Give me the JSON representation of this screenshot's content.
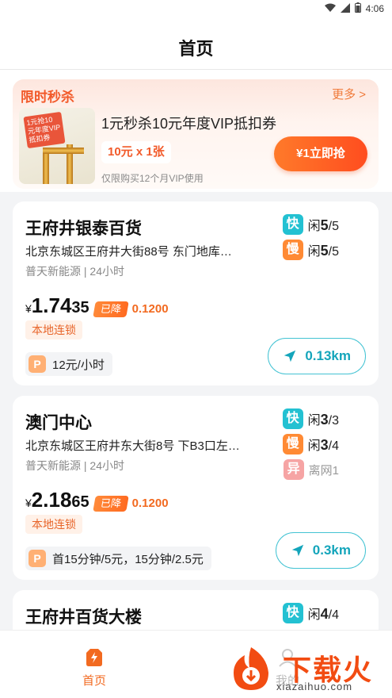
{
  "status": {
    "time": "4:06"
  },
  "header": {
    "title": "首页"
  },
  "promo": {
    "label": "限时秒杀",
    "more": "更多 >",
    "thumb_text": "1元抢10元年度VIP抵扣券",
    "title": "1元秒杀10元年度VIP抵扣券",
    "price_tag": "10元 x 1张",
    "note": "仅限购买12个月VIP使用",
    "buy_label": "¥1立即抢"
  },
  "stations": [
    {
      "name": "王府井银泰百货",
      "address": "北京东城区王府井大街88号 东门地库…",
      "operator": "普天新能源 | 24小时",
      "yen": "¥",
      "price_big": "1.74",
      "price_small": "35",
      "drop_label": "已降",
      "drop_value": "0.1200",
      "chain": "本地连锁",
      "fee_icon": "P",
      "fee": "12元/小时",
      "distance": "0.13km",
      "fast": {
        "badge": "快",
        "prefix": "闲",
        "free": "5",
        "total": "/5"
      },
      "slow": {
        "badge": "慢",
        "prefix": "闲",
        "free": "5",
        "total": "/5"
      }
    },
    {
      "name": "澳门中心",
      "address": "北京东城区王府井东大街8号 下B3口左…",
      "operator": "普天新能源 | 24小时",
      "yen": "¥",
      "price_big": "2.18",
      "price_small": "65",
      "drop_label": "已降",
      "drop_value": "0.1200",
      "chain": "本地连锁",
      "fee_icon": "P",
      "fee": "首15分钟/5元，15分钟/2.5元",
      "distance": "0.3km",
      "fast": {
        "badge": "快",
        "prefix": "闲",
        "free": "3",
        "total": "/3"
      },
      "slow": {
        "badge": "慢",
        "prefix": "闲",
        "free": "3",
        "total": "/4"
      },
      "other": {
        "badge": "异",
        "text": "离网1"
      }
    },
    {
      "name": "王府井百货大楼",
      "fast": {
        "badge": "快",
        "prefix": "闲",
        "free": "4",
        "total": "/4"
      }
    }
  ],
  "tabbar": {
    "home": "首页",
    "mine": "我的"
  },
  "watermark": {
    "text": "下载火",
    "url": "xiazaihuo.com"
  },
  "colors": {
    "accent": "#f26a20",
    "fast": "#23c1d2",
    "slow": "#ff8a34",
    "distance": "#14a5bb"
  }
}
